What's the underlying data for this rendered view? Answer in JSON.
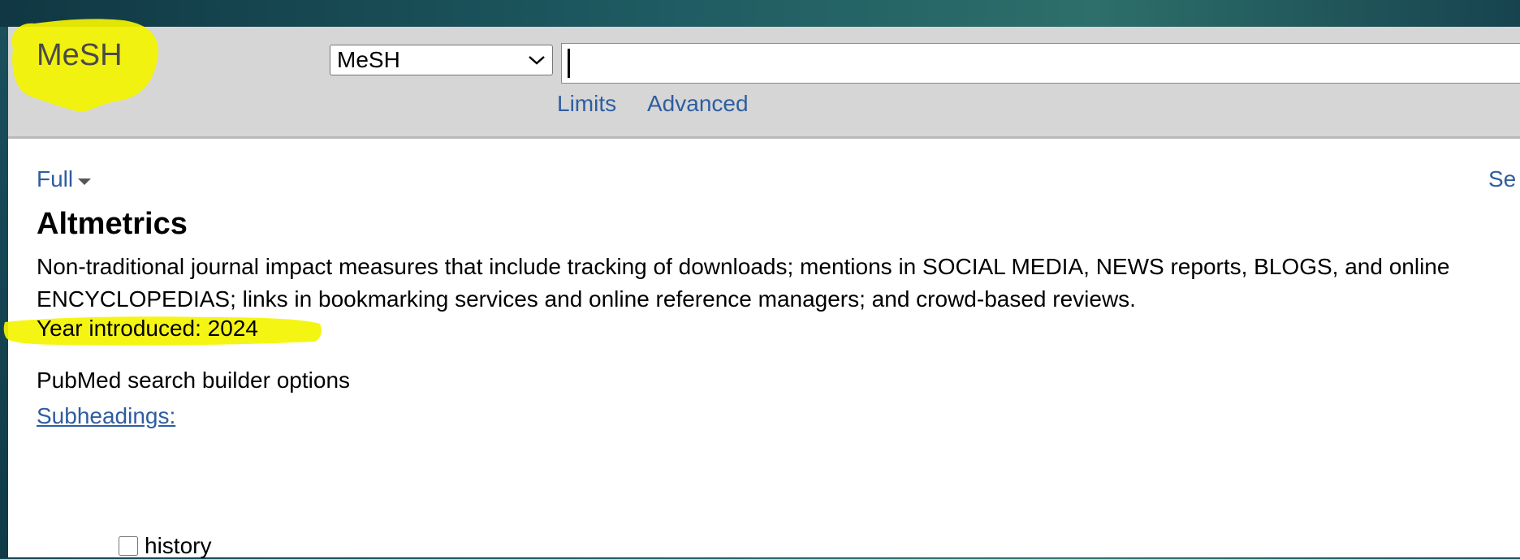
{
  "header": {
    "app_title": "MeSH",
    "database_select": {
      "selected": "MeSH",
      "options": [
        "MeSH"
      ]
    },
    "search": {
      "value": "",
      "placeholder": ""
    },
    "links": {
      "limits": "Limits",
      "advanced": "Advanced"
    }
  },
  "toolbar": {
    "format_label": "Full",
    "right_link_partial": "Se"
  },
  "record": {
    "term": "Altmetrics",
    "scope_note": "Non-traditional journal impact measures that include tracking of downloads; mentions in SOCIAL MEDIA, NEWS reports, BLOGS, and online ENCYCLOPEDIAS; links in bookmarking services and online reference managers; and crowd-based reviews.",
    "year_introduced_label": "Year introduced:",
    "year_introduced_value": "2024"
  },
  "search_builder": {
    "heading": "PubMed search builder options",
    "subheadings_link": "Subheadings:",
    "subheadings": [
      {
        "label": "history",
        "checked": false
      }
    ]
  },
  "annotations": {
    "highlight_color": "#f5f500"
  },
  "colors": {
    "link": "#2f5da0",
    "header_bg": "#d6d6d6",
    "frame_teal": "#1e5a62"
  }
}
